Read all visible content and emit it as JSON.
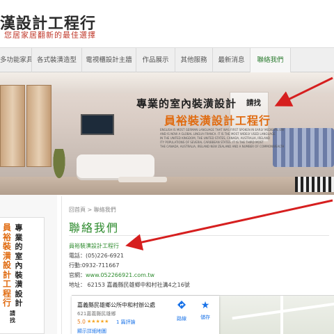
{
  "header": {
    "site_title": "漢設計工程行",
    "tagline": "您居家居翻新的最佳選擇"
  },
  "nav": {
    "items": [
      {
        "label": "多功能家具",
        "active": false
      },
      {
        "label": "各式裝潢造型",
        "active": false
      },
      {
        "label": "電視櫃設計主牆",
        "active": false
      },
      {
        "label": "作品展示",
        "active": false
      },
      {
        "label": "其他服務",
        "active": false
      },
      {
        "label": "最新消息",
        "active": false
      },
      {
        "label": "聯絡我們",
        "active": true
      }
    ]
  },
  "banner": {
    "headline": "專業的室內裝潢設計",
    "request": "請找",
    "company": "員裕裝潢設計工程行",
    "small_text": [
      "ENGLISH IS MOST GERMAN LANGUAGE THAT WAS FIRST SPOKEN IN EARLY MEDIEVAL ENGLAND",
      "AND IS NOW A GLOBAL LINGUA FRANCA. IT IS THE MOST WIDELY USED LANGUAGE",
      "IN THE UNITED KINGDOM, THE UNITED STATES, CANADA, AUSTRALIA, IRELAND",
      "ITY POPULATIONS OF SEVERAL CARIBBEAN STATES. IT IS THE THIRD MOST",
      "THE CANADA, AUSTRALIA, IRELAND NEW ZEALAND AND A NUMBER OF COMMONWEALTH NATIONS"
    ]
  },
  "sidebar": {
    "col_black": "專業的室內裝潢設計",
    "col_orange": "員裕裝潢設計工程行",
    "col_request": "請找"
  },
  "content": {
    "breadcrumb": "回首頁 > 聯絡我們",
    "heading": "聯絡我們",
    "company_link": "員裕裝潢設計工程行",
    "phone": "電話：(05)226-6921",
    "mobile": "行動:0932-711667",
    "website_label": "官網：",
    "website_url": "www.052266921.com.tw",
    "address": "地址：  62153 嘉義縣民雄鄉中和村社溝4之16號"
  },
  "map": {
    "place_name": "嘉義縣民雄鄉公所中和村辦公處",
    "place_address": "621嘉義縣民雄鄉",
    "rating": "5.0",
    "stars": "★★★★★",
    "reviews": "1 篇評論",
    "larger_map": "顯示詳細地圖",
    "directions_label": "路線",
    "save_label": "儲存",
    "directions_icon": "directions-icon",
    "save_icon": "star-icon"
  },
  "colors": {
    "accent_green": "#2e8b2e",
    "accent_orange": "#e06b10",
    "arrow_red": "#d61f1f"
  }
}
